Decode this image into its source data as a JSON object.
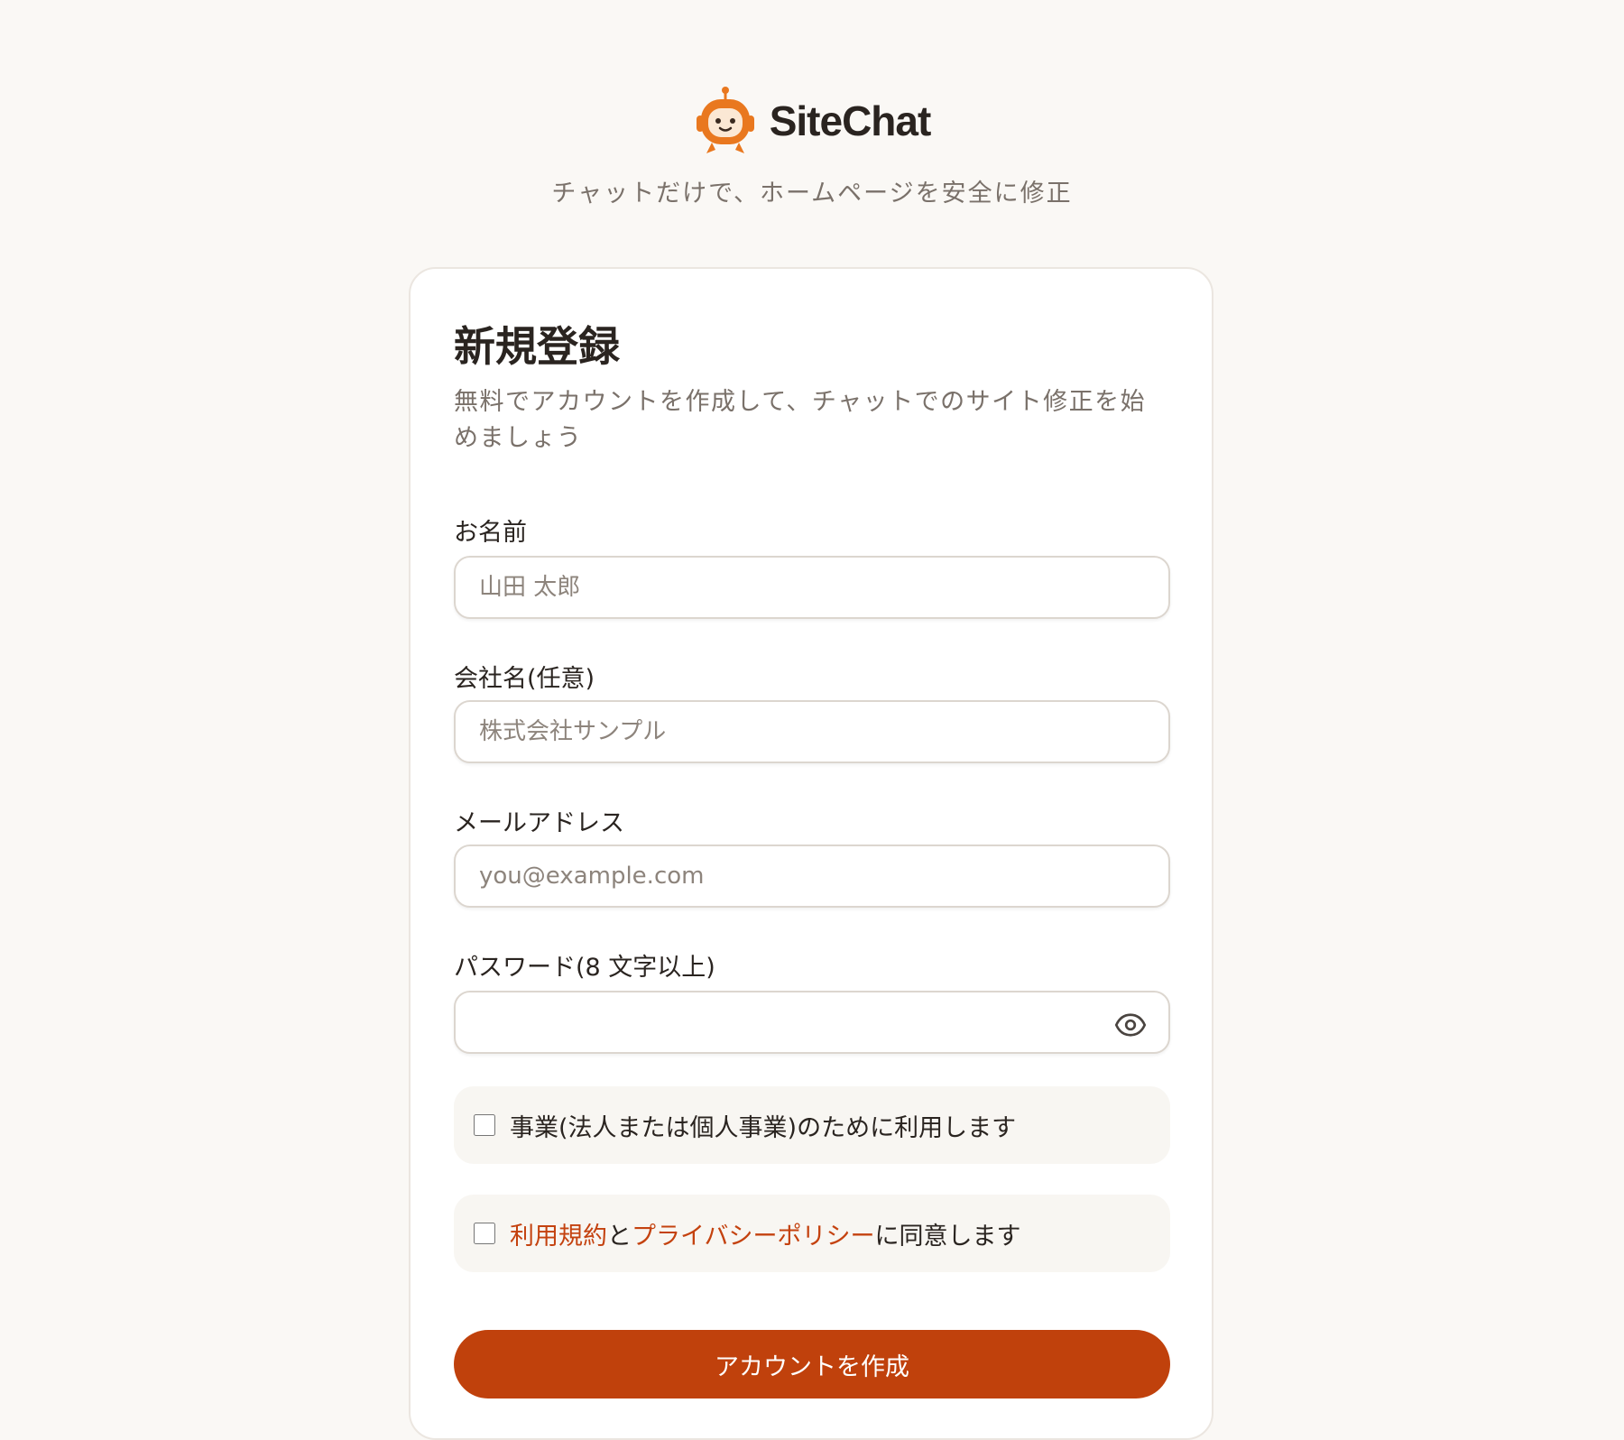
{
  "brand": {
    "name": "SiteChat",
    "logo_icon": "robot-icon"
  },
  "tagline": "チャットだけで、ホームページを安全に修正",
  "form": {
    "title": "新規登録",
    "description": "無料でアカウントを作成して、チャットでのサイト修正を始めましょう",
    "name": {
      "label": "お名前",
      "placeholder": "山田 太郎"
    },
    "company": {
      "label": "会社名(任意)",
      "placeholder": "株式会社サンプル"
    },
    "email": {
      "label": "メールアドレス",
      "placeholder": "you@example.com"
    },
    "password": {
      "label": "パスワード(8 文字以上)",
      "placeholder": "",
      "toggle_icon": "eye-icon"
    },
    "business_check": {
      "label": "事業(法人または個人事業)のために利用します",
      "checked": false
    },
    "terms_check": {
      "checked": false,
      "terms_link": "利用規約",
      "connector": "と",
      "privacy_link": "プライバシーポリシー",
      "suffix": "に同意します"
    },
    "submit_label": "アカウントを作成"
  },
  "colors": {
    "accent": "#c0410c",
    "background": "#faf8f5",
    "logo": "#e9781f"
  }
}
